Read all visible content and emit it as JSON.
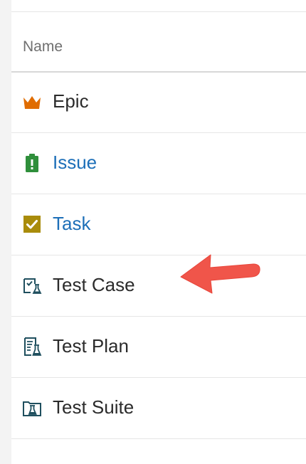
{
  "table": {
    "header": "Name",
    "rows": [
      {
        "label": "Epic",
        "icon": "crown-icon",
        "link": false,
        "color": "#e06c00"
      },
      {
        "label": "Issue",
        "icon": "clipboard-issue-icon",
        "link": true,
        "color": "#2f8f3b"
      },
      {
        "label": "Task",
        "icon": "checkbox-task-icon",
        "link": true,
        "color": "#a98c0b"
      },
      {
        "label": "Test Case",
        "icon": "test-case-icon",
        "link": false,
        "color": "#1f4f5e"
      },
      {
        "label": "Test Plan",
        "icon": "test-plan-icon",
        "link": false,
        "color": "#1f4f5e"
      },
      {
        "label": "Test Suite",
        "icon": "test-suite-icon",
        "link": false,
        "color": "#1f4f5e"
      }
    ]
  },
  "annotation": {
    "arrow_color": "#f0554a",
    "target": "Test Case"
  }
}
